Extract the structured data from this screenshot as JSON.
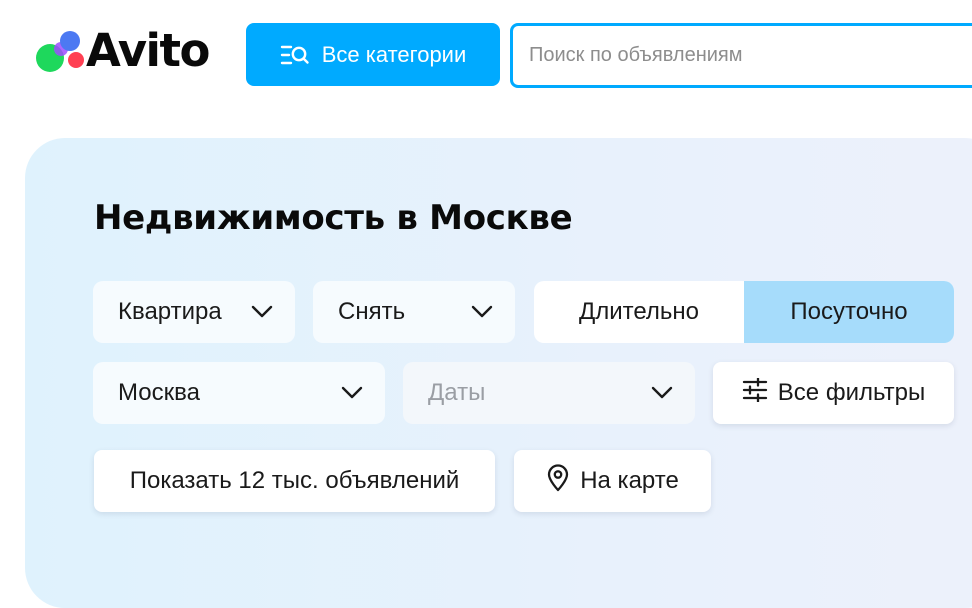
{
  "header": {
    "logo_text": "Avito",
    "categories_button": "Все категории",
    "search_placeholder": "Поиск по объявлениям"
  },
  "main": {
    "title": "Недвижимость в Москве",
    "property_type": "Квартира",
    "deal_type": "Снять",
    "rent_period": {
      "options": [
        "Длительно",
        "Посуточно"
      ],
      "selected": "Посуточно"
    },
    "city": "Москва",
    "dates_placeholder": "Даты",
    "filters_button": "Все фильтры",
    "show_button": "Показать 12 тыс. объявлений",
    "map_button": "На карте"
  },
  "icons": {
    "categories": "list-search-icon",
    "dropdown": "chevron-down-icon",
    "filters": "sliders-icon",
    "map": "map-pin-icon"
  },
  "colors": {
    "accent": "#00aaff",
    "segment_active": "#a6dcfb",
    "panel_bg": "#e3f2fd"
  }
}
